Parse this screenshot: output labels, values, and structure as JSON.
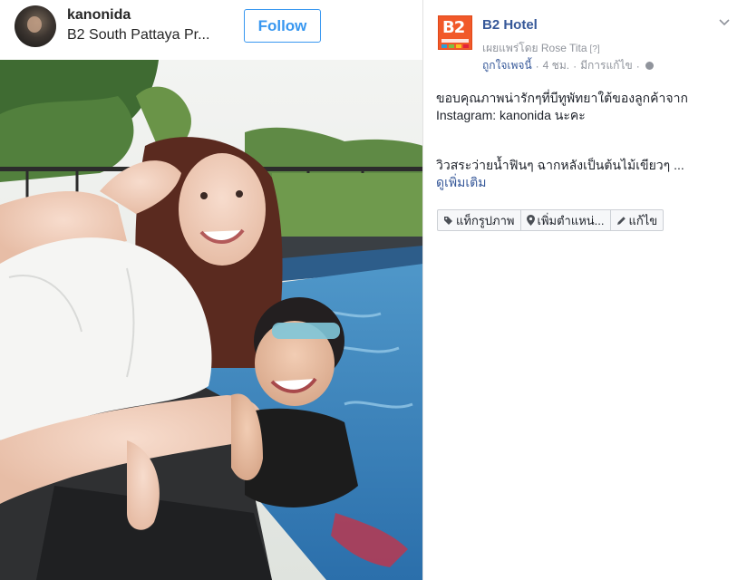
{
  "instagram": {
    "username": "kanonida",
    "location": "B2 South Pattaya Pr...",
    "follow_label": "Follow"
  },
  "facebook": {
    "page_name": "B2 Hotel",
    "logo_text": "B2",
    "publisher_label": "เผยแพร่โดย Rose Tita",
    "publisher_help": "[?]",
    "liked_label": "ถูกใจเพจนี้",
    "time": "4 ชม.",
    "edited": "มีการแก้ไข",
    "post_line1": "ขอบคุณภาพน่ารักๆที่บีทูพัทยาใต้ของลูกค้าจาก",
    "post_line2": "Instagram: kanonida นะคะ",
    "post_line3": "วิวสระว่ายน้ำฟินๆ ฉากหลังเป็นต้นไม้เขียวๆ ...",
    "see_more": "ดูเพิ่มเติม",
    "actions": {
      "tag_photo": "แท็กรูปภาพ",
      "add_location": "เพิ่มตำแหน่...",
      "edit": "แก้ไข"
    },
    "colors": {
      "link": "#365899",
      "meta": "#90949c",
      "logo": "#f1592a",
      "follow": "#3897f0"
    }
  }
}
